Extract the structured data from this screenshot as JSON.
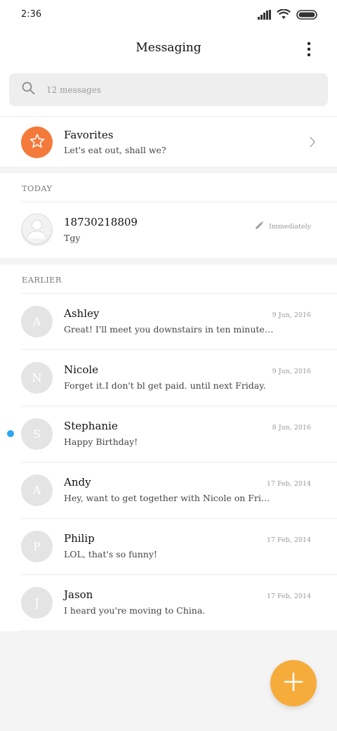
{
  "status_bar": {
    "time": "2:36"
  },
  "app_bar": {
    "title": "Messaging"
  },
  "search": {
    "placeholder": "12 messages"
  },
  "favorites": {
    "label": "Favorites",
    "snippet": "Let's eat out, shall we?"
  },
  "sections": {
    "today": "TODAY",
    "earlier": "EARLIER"
  },
  "today_messages": [
    {
      "name": "18730218809",
      "snippet": "Tgy",
      "time": "Immediately"
    }
  ],
  "earlier_messages": [
    {
      "initial": "A",
      "name": "Ashley",
      "snippet": "Great! I'll meet you downstairs in ten minutes. D…",
      "date": "9 Jun, 2016"
    },
    {
      "initial": "N",
      "name": "Nicole",
      "snippet": "Forget it.I don't bl get paid. until next Friday.",
      "date": "9 Jun, 2016"
    },
    {
      "initial": "S",
      "name": "Stephanie",
      "snippet": "Happy Birthday!",
      "date": "8 Jun, 2016",
      "unread": true
    },
    {
      "initial": "A",
      "name": "Andy",
      "snippet": "Hey, want to get together with Nicole on Friday?",
      "date": "17 Feb, 2014"
    },
    {
      "initial": "P",
      "name": "Philip",
      "snippet": "LOL, that's so funny!",
      "date": "17 Feb, 2014"
    },
    {
      "initial": "J",
      "name": "Jason",
      "snippet": "I heard you're moving to China.",
      "date": "17 Feb, 2014"
    }
  ],
  "icons": {
    "signal": "signal-icon",
    "wifi": "wifi-icon",
    "battery": "battery-icon",
    "more": "more-vertical-icon",
    "search": "search-icon",
    "star": "star-icon",
    "chevron": "chevron-right-icon",
    "pencil": "pencil-icon",
    "add": "plus-icon"
  },
  "colors": {
    "favorites_accent": "#f47a3c",
    "fab": "#f5ac3b",
    "unread_dot": "#2da6f0",
    "avatar_placeholder": "#e4e4e4"
  }
}
